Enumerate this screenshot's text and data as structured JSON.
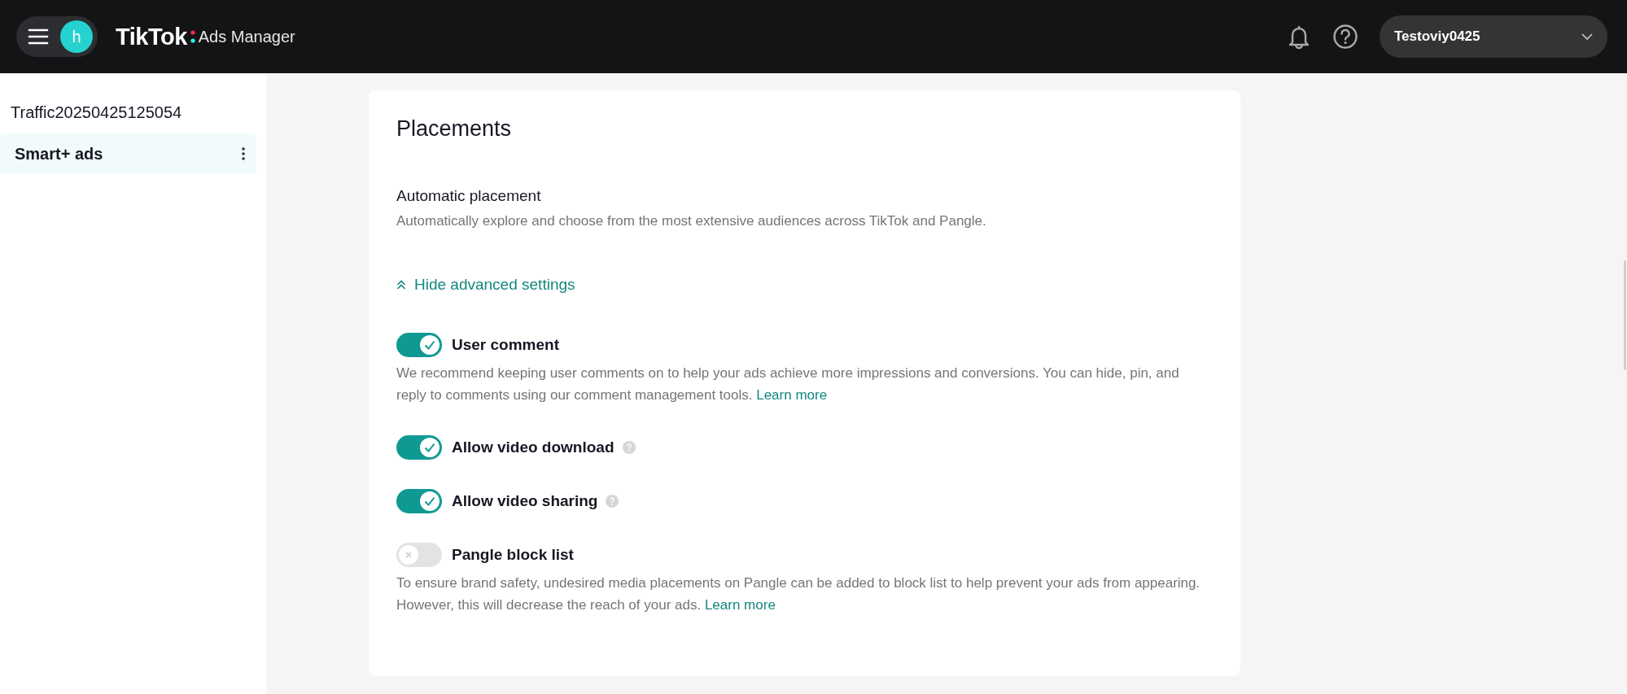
{
  "header": {
    "avatar_letter": "h",
    "brand": "TikTok",
    "product": "Ads Manager",
    "account": "Testoviy0425"
  },
  "sidebar": {
    "campaign": "Traffic20250425125054",
    "items": [
      {
        "label": "Smart+ ads",
        "selected": true
      }
    ]
  },
  "section": {
    "title": "Placements",
    "placement": {
      "label": "Automatic placement",
      "description": "Automatically explore and choose from the most extensive audiences across TikTok and Pangle."
    },
    "advanced_toggle": {
      "label": "Hide advanced settings",
      "expanded": true
    },
    "settings": [
      {
        "label": "User comment",
        "on": true,
        "info": false,
        "description": "We recommend keeping user comments on to help your ads achieve more impressions and conversions. You can hide, pin, and reply to comments using our comment management tools.",
        "link": "Learn more"
      },
      {
        "label": "Allow video download",
        "on": true,
        "info": true
      },
      {
        "label": "Allow video sharing",
        "on": true,
        "info": true
      },
      {
        "label": "Pangle block list",
        "on": false,
        "info": false,
        "description": "To ensure brand safety, undesired media placements on Pangle can be added to block list to help prevent your ads from appearing. However, this will decrease the reach of your ads.",
        "link": "Learn more"
      }
    ]
  }
}
